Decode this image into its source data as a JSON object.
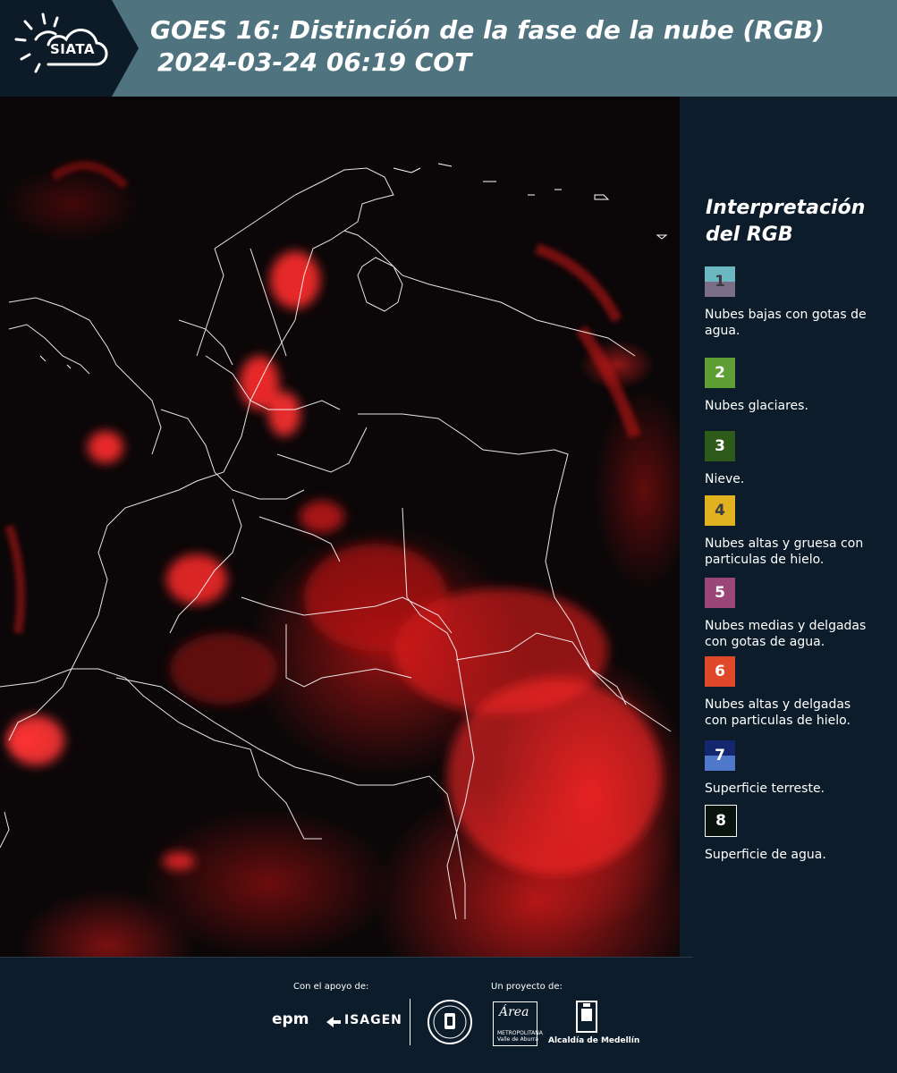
{
  "header": {
    "logo_text": "SIATA",
    "title_line1": "GOES 16: Distinción de la fase de la nube (RGB)",
    "title_line2": "2024-03-24 06:19 COT"
  },
  "legend": {
    "title_line1": "Interpretación",
    "title_line2": "del RGB",
    "items": [
      {
        "num": "1",
        "label": "Nubes bajas con gotas de agua.",
        "color_top": "#6bb8c2",
        "color_bottom": "#7a6e86",
        "text_color": "#3b3b45"
      },
      {
        "num": "2",
        "label": "Nubes glaciares.",
        "color_top": "#5e9e35",
        "color_bottom": "#5e9e35",
        "text_color": "#ffffff"
      },
      {
        "num": "3",
        "label": "Nieve.",
        "color_top": "#2e5a1a",
        "color_bottom": "#2e5a1a",
        "text_color": "#ffffff"
      },
      {
        "num": "4",
        "label": "Nubes altas y gruesa con particulas de hielo.",
        "color_top": "#e0b21f",
        "color_bottom": "#e0b21f",
        "text_color": "#3b3b45"
      },
      {
        "num": "5",
        "label": "Nubes medias y delgadas con gotas de agua.",
        "color_top": "#9a4778",
        "color_bottom": "#9a4778",
        "text_color": "#ffffff"
      },
      {
        "num": "6",
        "label": "Nubes altas y delgadas con particulas de hielo.",
        "color_top": "#e0482a",
        "color_bottom": "#e0482a",
        "text_color": "#ffffff"
      },
      {
        "num": "7",
        "label": "Superficie terreste.",
        "color_top": "#14266e",
        "color_bottom": "#4e79c9",
        "text_color": "#ffffff"
      },
      {
        "num": "8",
        "label": "Superficie de agua.",
        "color_top": "#0a140e",
        "color_bottom": "#0a140e",
        "text_color": "#ffffff"
      }
    ]
  },
  "footer": {
    "support_label": "Con el apoyo de:",
    "project_label": "Un proyecto de:",
    "sponsor_epm": "epm",
    "sponsor_isagen": "ISAGEN",
    "area_script": "Área",
    "area_text_line1": "METROPOLITANA",
    "area_text_line2": "Valle de Aburrá",
    "medellin": "Alcaldía de Medellín"
  },
  "colors": {
    "header_bg": "#4f7480",
    "panel_bg": "#0c1c2a",
    "cloud_red": "#e02020"
  }
}
